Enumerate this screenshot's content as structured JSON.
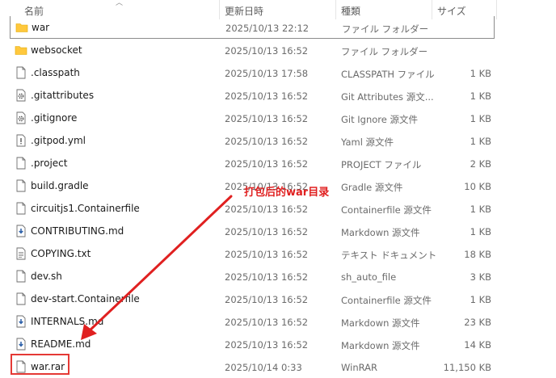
{
  "columns": {
    "name": "名前",
    "date": "更新日時",
    "type": "種類",
    "size": "サイズ"
  },
  "colors": {
    "folder": "#ffc83d",
    "annotation": "#e02020",
    "highlight": "#e53935"
  },
  "annotation_text": "打包后的war目录",
  "files": [
    {
      "icon": "folder-icon",
      "name": "war",
      "date": "2025/10/13 22:12",
      "type": "ファイル フォルダー",
      "size": ""
    },
    {
      "icon": "folder-icon",
      "name": "websocket",
      "date": "2025/10/13 16:52",
      "type": "ファイル フォルダー",
      "size": ""
    },
    {
      "icon": "document-icon",
      "name": ".classpath",
      "date": "2025/10/13 17:58",
      "type": "CLASSPATH ファイル",
      "size": "1 KB"
    },
    {
      "icon": "gear-document-icon",
      "name": ".gitattributes",
      "date": "2025/10/13 16:52",
      "type": "Git Attributes 源文...",
      "size": "1 KB"
    },
    {
      "icon": "gear-document-icon",
      "name": ".gitignore",
      "date": "2025/10/13 16:52",
      "type": "Git Ignore 源文件",
      "size": "1 KB"
    },
    {
      "icon": "exclaim-document-icon",
      "name": ".gitpod.yml",
      "date": "2025/10/13 16:52",
      "type": "Yaml 源文件",
      "size": "1 KB"
    },
    {
      "icon": "document-icon",
      "name": ".project",
      "date": "2025/10/13 16:52",
      "type": "PROJECT ファイル",
      "size": "2 KB"
    },
    {
      "icon": "document-icon",
      "name": "build.gradle",
      "date": "2025/10/13 16:52",
      "type": "Gradle 源文件",
      "size": "10 KB"
    },
    {
      "icon": "document-icon",
      "name": "circuitjs1.Containerfile",
      "date": "2025/10/13 16:52",
      "type": "Containerfile 源文件",
      "size": "1 KB"
    },
    {
      "icon": "markdown-icon",
      "name": "CONTRIBUTING.md",
      "date": "2025/10/13 16:52",
      "type": "Markdown 源文件",
      "size": "1 KB"
    },
    {
      "icon": "text-document-icon",
      "name": "COPYING.txt",
      "date": "2025/10/13 16:52",
      "type": "テキスト ドキュメント",
      "size": "18 KB"
    },
    {
      "icon": "document-icon",
      "name": "dev.sh",
      "date": "2025/10/13 16:52",
      "type": "sh_auto_file",
      "size": "3 KB"
    },
    {
      "icon": "document-icon",
      "name": "dev-start.Containerfile",
      "date": "2025/10/13 16:52",
      "type": "Containerfile 源文件",
      "size": "1 KB"
    },
    {
      "icon": "markdown-icon",
      "name": "INTERNALS.md",
      "date": "2025/10/13 16:52",
      "type": "Markdown 源文件",
      "size": "23 KB"
    },
    {
      "icon": "markdown-icon",
      "name": "README.md",
      "date": "2025/10/13 16:52",
      "type": "Markdown 源文件",
      "size": "14 KB"
    },
    {
      "icon": "document-icon",
      "name": "war.rar",
      "date": "2025/10/14 0:33",
      "type": "WinRAR",
      "size": "11,150 KB"
    }
  ]
}
